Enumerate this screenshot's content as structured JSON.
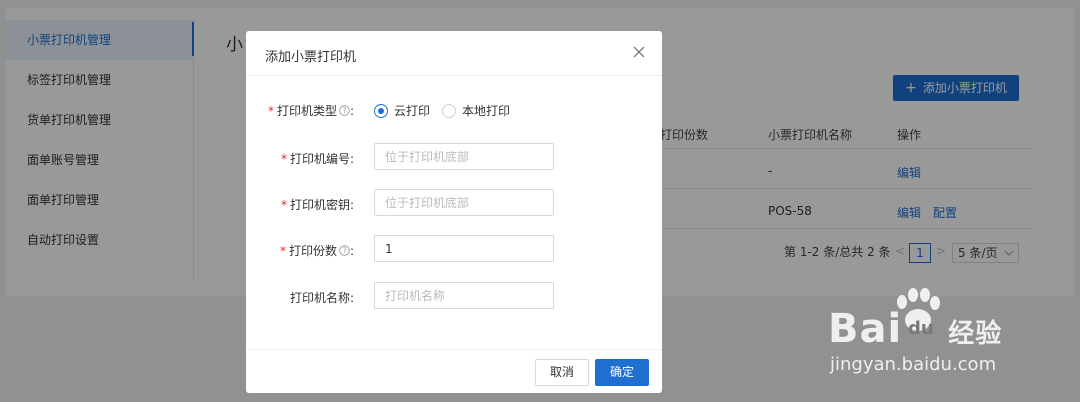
{
  "sidebar": {
    "items": [
      {
        "label": "小票打印机管理",
        "active": true
      },
      {
        "label": "标签打印机管理"
      },
      {
        "label": "货单打印机管理"
      },
      {
        "label": "面单账号管理"
      },
      {
        "label": "面单打印管理"
      },
      {
        "label": "自动打印设置"
      }
    ]
  },
  "main": {
    "title": "小",
    "add_button": "添加小票打印机",
    "table": {
      "headers": [
        "打印份数",
        "小票打印机名称",
        "操作"
      ],
      "rows": [
        {
          "name": "-",
          "actions": [
            "编辑"
          ]
        },
        {
          "name": "POS-58",
          "actions": [
            "编辑",
            "配置"
          ]
        }
      ]
    },
    "pagination": {
      "summary": "第 1-2 条/总共 2 条",
      "prev": "<",
      "current_page": "1",
      "next": ">",
      "page_size": "5 条/页"
    }
  },
  "modal": {
    "title": "添加小票打印机",
    "fields": {
      "type": {
        "label": "打印机类型",
        "options": [
          "云打印",
          "本地打印"
        ],
        "selected": "云打印"
      },
      "serial": {
        "label": "打印机编号",
        "placeholder": "位于打印机底部"
      },
      "key": {
        "label": "打印机密钥",
        "placeholder": "位于打印机底部"
      },
      "copies": {
        "label": "打印份数",
        "value": "1"
      },
      "name": {
        "label": "打印机名称",
        "placeholder": "打印机名称"
      }
    },
    "colon": ":",
    "required_mark": "*",
    "cancel": "取消",
    "confirm": "确定"
  },
  "watermark": {
    "brand": "Bai",
    "brand2": "du",
    "cn": "经验",
    "url": "jingyan.baidu.com"
  },
  "colors": {
    "primary": "#1f6fd1",
    "required": "#f5222d"
  }
}
